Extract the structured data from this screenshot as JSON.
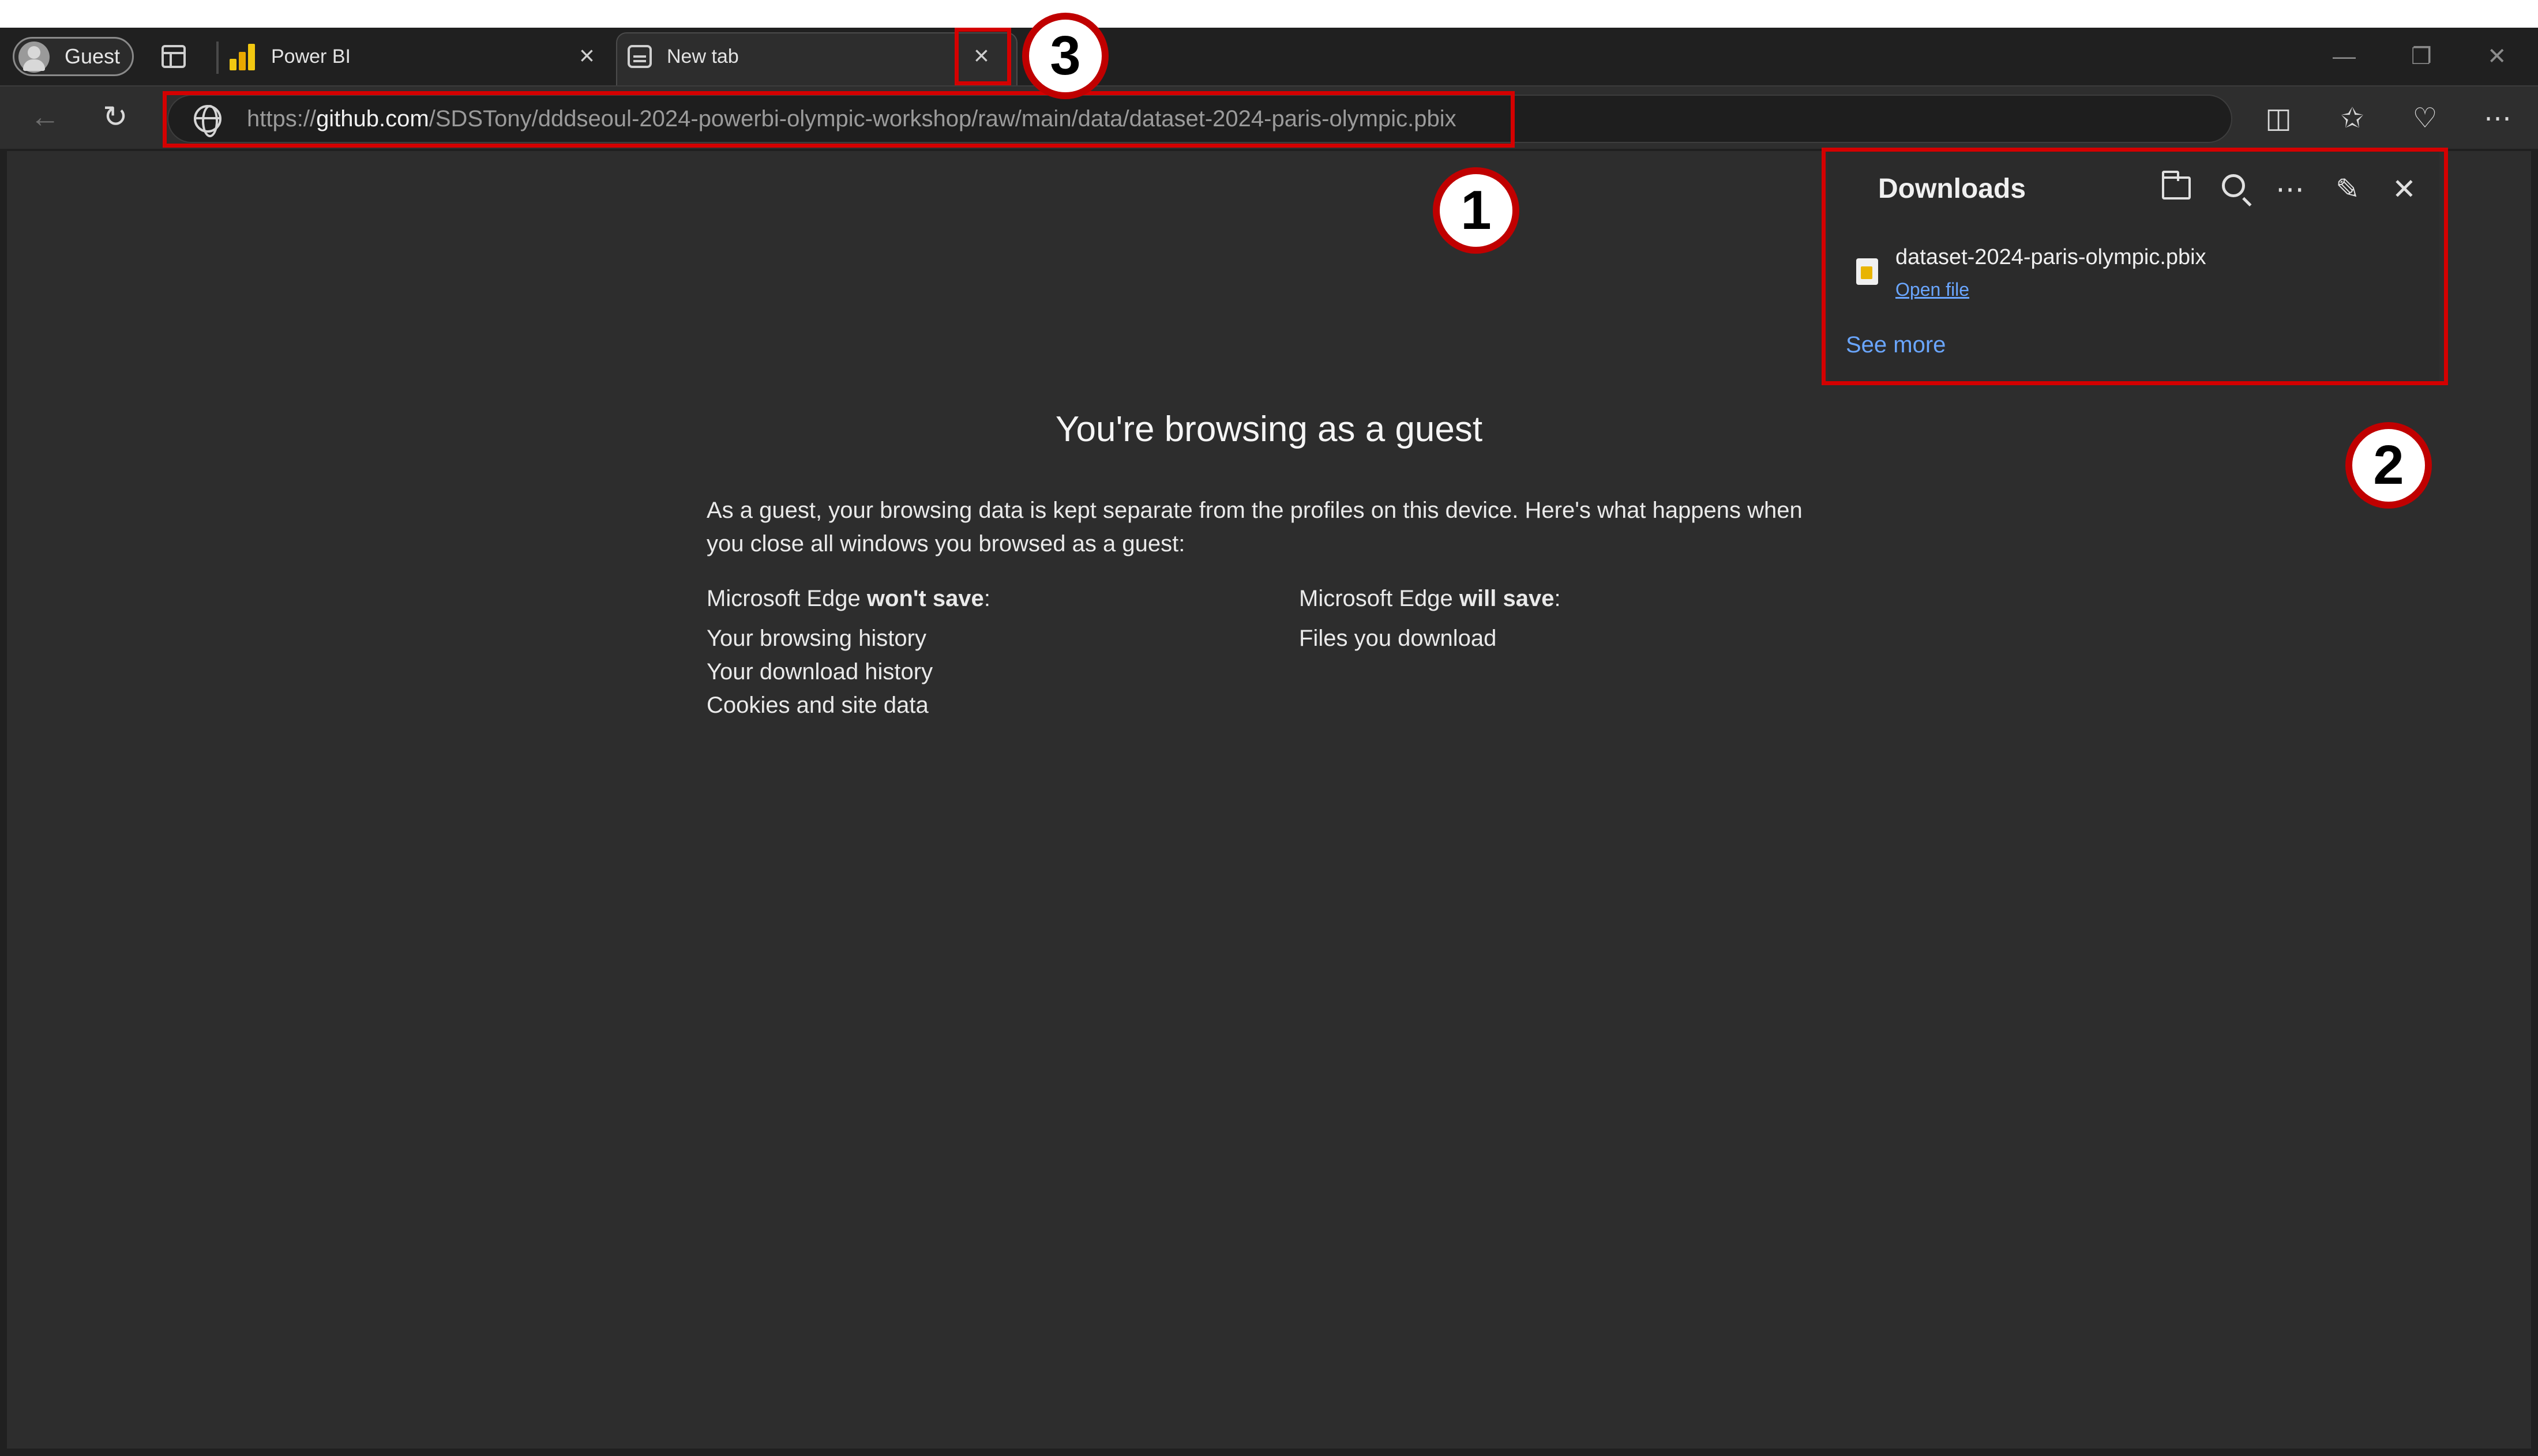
{
  "profile": {
    "name": "Guest"
  },
  "tabs": [
    {
      "label": "Power BI",
      "close": "×"
    },
    {
      "label": "New tab",
      "close": "×"
    }
  ],
  "window_controls": {
    "minimize": "—",
    "restore": "❐",
    "close": "✕"
  },
  "toolbar": {
    "back": "←",
    "refresh": "↻",
    "url_scheme": "https://",
    "url_host": "github.com",
    "url_path": "/SDSTony/dddseoul-2024-powerbi-olympic-workshop/raw/main/data/dataset-2024-paris-olympic.pbix",
    "split_screen": "◫",
    "favorites": "✩",
    "browser_essentials": "♡",
    "more": "⋯"
  },
  "downloads": {
    "title": "Downloads",
    "more": "⋯",
    "pin": "✎",
    "close": "✕",
    "file_name": "dataset-2024-paris-olympic.pbix",
    "open_file": "Open file",
    "see_more": "See more"
  },
  "page": {
    "title": "You're browsing as a guest",
    "description": "As a guest, your browsing data is kept separate from the profiles on this device. Here's what happens when you close all windows you browsed as a guest:",
    "wont_save_prefix": "Microsoft Edge ",
    "wont_save_bold": "won't save",
    "wont_save_items": [
      "Your browsing history",
      "Your download history",
      "Cookies and site data"
    ],
    "will_save_prefix": "Microsoft Edge ",
    "will_save_bold": "will save",
    "will_save_items": [
      "Files you download"
    ],
    "colon": ":"
  },
  "annotations": {
    "step1": "1",
    "step2": "2",
    "step3": "3"
  },
  "colors": {
    "annotation_red": "#d40000",
    "link_blue": "#6aa6ff",
    "background": "#2d2d2d"
  }
}
